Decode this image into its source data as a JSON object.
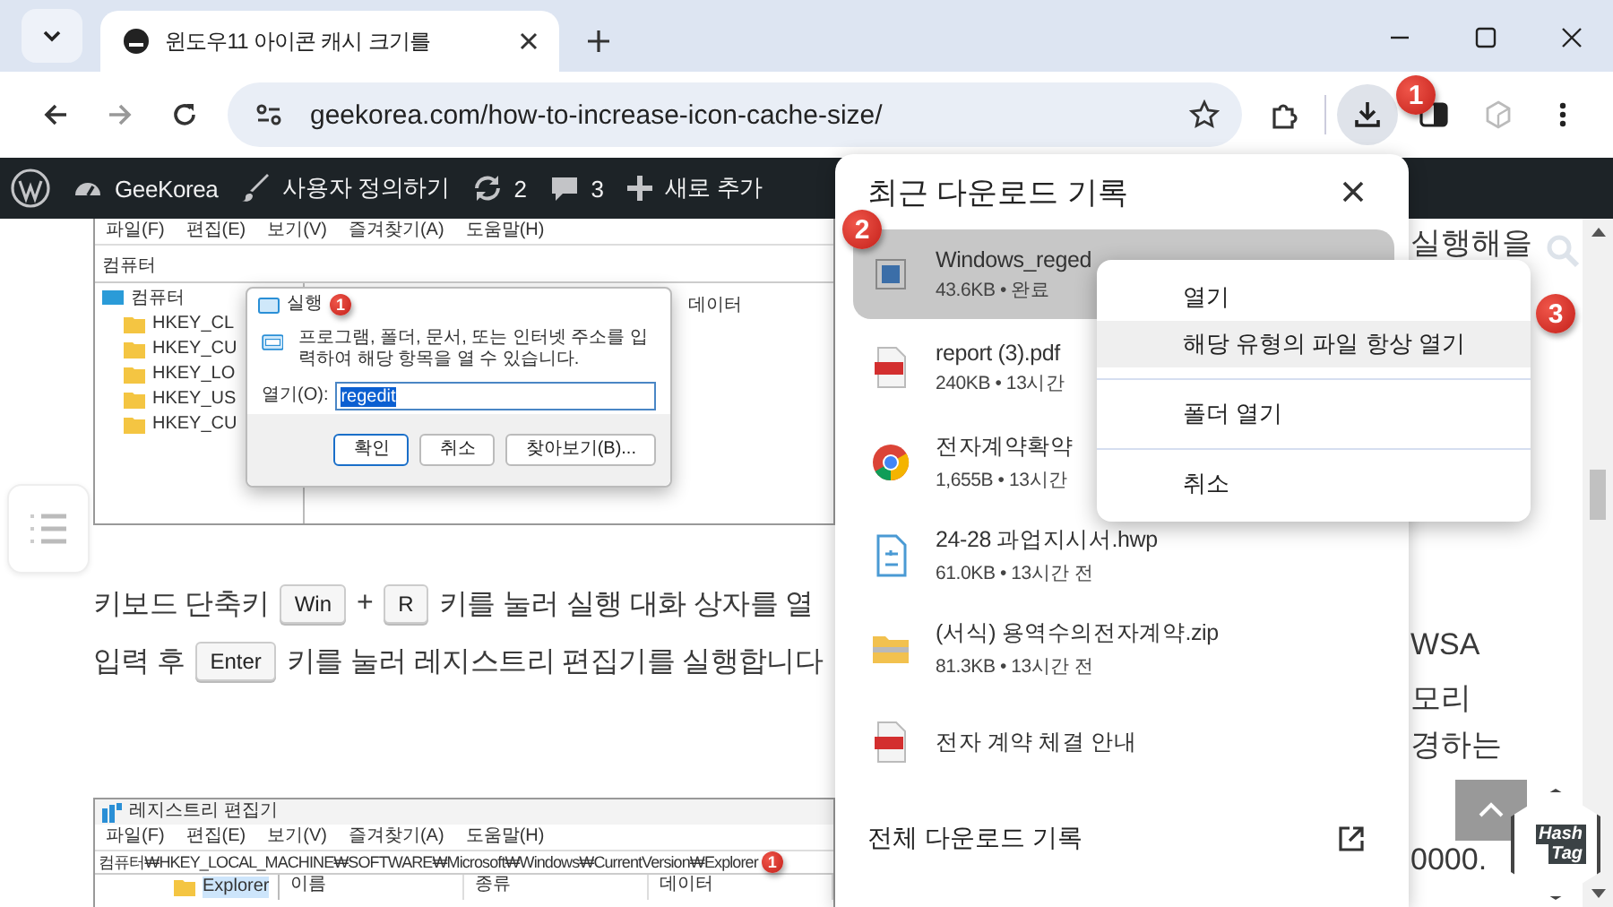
{
  "tabs": [
    {
      "title": "윈도우11 아이콘 캐시 크기를",
      "selected": true
    }
  ],
  "toolbar": {
    "url": "geekorea.com/how-to-increase-icon-cache-size/",
    "downloads_active": true
  },
  "admin_bar": {
    "site": "GeeKorea",
    "customize": "사용자 정의하기",
    "updates": "2",
    "comments": "3",
    "new": "새로 추가"
  },
  "article": {
    "screenshot_1": {
      "menu": [
        "파일(F)",
        "편집(E)",
        "보기(V)",
        "즐겨찾기(A)",
        "도움말(H)"
      ],
      "address": "컴퓨터",
      "tree_root": "컴퓨터",
      "tree": [
        "HKEY_CL",
        "HKEY_CU",
        "HKEY_LO",
        "HKEY_US",
        "HKEY_CU"
      ],
      "column": "데이터",
      "dialog": {
        "title": "실행",
        "marker": "1",
        "message": "프로그램, 폴더, 문서, 또는 인터넷 주소를 입력하여 해당 항목을 열 수 있습니다.",
        "label": "열기(O):",
        "value": "regedit",
        "buttons": [
          "확인",
          "취소",
          "찾아보기(B)..."
        ]
      }
    },
    "lines": [
      [
        {
          "kind": "text",
          "text": "키보드 단축키"
        },
        {
          "kind": "key",
          "text": "Win"
        },
        {
          "kind": "text",
          "text": "+"
        },
        {
          "kind": "key",
          "text": "R"
        },
        {
          "kind": "text",
          "text": "키를 눌러 실행 대화 상자를 열"
        }
      ],
      [
        {
          "kind": "text",
          "text": "입력 후"
        },
        {
          "kind": "key",
          "text": "Enter"
        },
        {
          "kind": "text",
          "text": "키를 눌러 레지스트리 편집기를 실행합니다"
        }
      ]
    ],
    "screenshot_2": {
      "title": "레지스트리 편집기",
      "menu": [
        "파일(F)",
        "편집(E)",
        "보기(V)",
        "즐겨찾기(A)",
        "도움말(H)"
      ],
      "address": "컴퓨터₩HKEY_LOCAL_MACHINE₩SOFTWARE₩Microsoft₩Windows₩CurrentVersion₩Explorer",
      "marker": "1",
      "tree": [
        "Explorer"
      ],
      "columns": [
        "이름",
        "종류",
        "데이터"
      ]
    },
    "right_fragments": [
      "실행해을",
      "WSA",
      "모리",
      "경하는",
      "0000."
    ]
  },
  "downloads": {
    "title": "최근 다운로드 기록",
    "marker": "2",
    "items": [
      {
        "kind": "reg",
        "name": "Windows_reged",
        "meta": "43.6KB • 완료",
        "selected": true
      },
      {
        "kind": "pdf",
        "name": "report (3).pdf",
        "meta": "240KB • 13시간",
        "selected": false
      },
      {
        "kind": "html",
        "name": "전자계약확약",
        "meta": "1,655B • 13시간",
        "selected": false
      },
      {
        "kind": "hwp",
        "name": "24-28 과업지시서.hwp",
        "meta": "61.0KB • 13시간 전",
        "selected": false
      },
      {
        "kind": "zip",
        "name": "(서식) 용역수의전자계약.zip",
        "meta": "81.3KB • 13시간 전",
        "selected": false
      },
      {
        "kind": "pdf",
        "name": "전자 계약 체결 안내",
        "selected": false
      }
    ],
    "footer": "전체 다운로드 기록"
  },
  "context_menu": {
    "marker": "3",
    "groups": [
      {
        "items": [
          {
            "label": "열기",
            "selected": false
          },
          {
            "label": "해당 유형의 파일 항상 열기",
            "selected": true
          }
        ]
      },
      {
        "items": [
          {
            "label": "폴더 열기",
            "selected": false
          }
        ]
      },
      {
        "items": [
          {
            "label": "취소",
            "selected": false
          }
        ]
      }
    ]
  },
  "toolbar_marker": "1",
  "logo": {
    "line1": "Hash",
    "line2": "Tag"
  }
}
